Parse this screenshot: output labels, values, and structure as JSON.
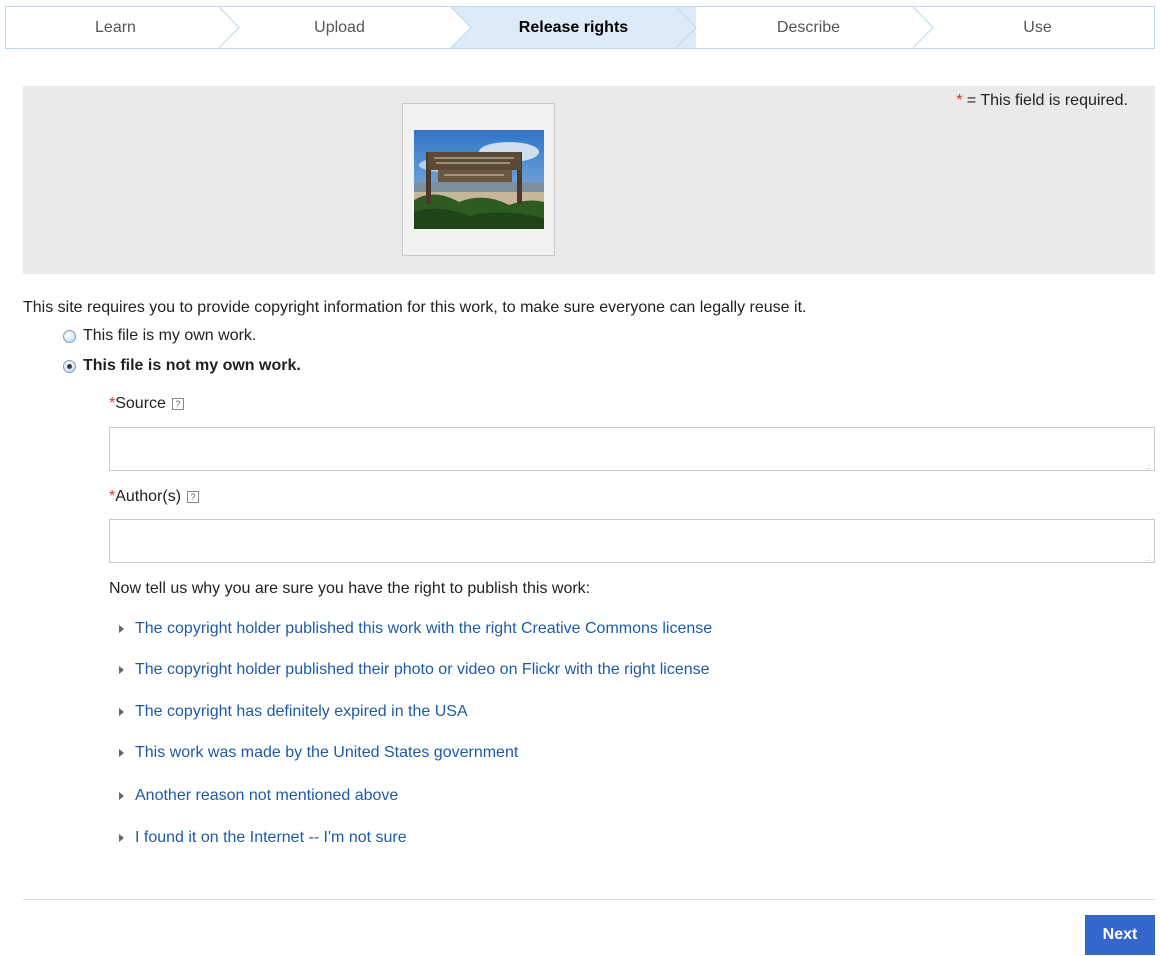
{
  "steps": [
    {
      "label": "Learn"
    },
    {
      "label": "Upload"
    },
    {
      "label": "Release rights",
      "active": true
    },
    {
      "label": "Describe"
    },
    {
      "label": "Use"
    }
  ],
  "preview": {
    "required_star": "*",
    "required_text": " = This field is required."
  },
  "intro_text": "This site requires you to provide copyright information for this work, to make sure everyone can legally reuse it.",
  "options": {
    "own_work": "This file is my own work.",
    "not_own_work": "This file is not my own work."
  },
  "fields": {
    "source": {
      "star": "*",
      "label": "Source",
      "help": "?",
      "value": ""
    },
    "authors": {
      "star": "*",
      "label": "Author(s)",
      "help": "?",
      "value": ""
    }
  },
  "why_text": "Now tell us why you are sure you have the right to publish this work:",
  "reasons": [
    "The copyright holder published this work with the right Creative Commons license",
    "The copyright holder published their photo or video on Flickr with the right license",
    "The copyright has definitely expired in the USA",
    "This work was made by the United States government",
    "Another reason not mentioned above",
    "I found it on the Internet -- I'm not sure"
  ],
  "next_label": "Next",
  "colors": {
    "active_step_bg": "#dcebf7",
    "link": "#1f5aa8",
    "required": "#dd3333",
    "primary_button": "#3466cc"
  }
}
